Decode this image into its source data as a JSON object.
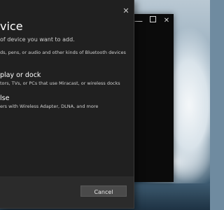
{
  "dialog": {
    "title": "vice",
    "subtitle": "of device you want to add.",
    "close_glyph": "✕",
    "options": [
      {
        "title": "",
        "desc": "ds, pens, or audio and other kinds of Bluetooth devices"
      },
      {
        "title": "play or dock",
        "desc": "tors, TVs, or PCs that use Miracast, or wireless docks"
      },
      {
        "title": "lse",
        "desc": "ers with Wireless Adapter, DLNA, and more"
      }
    ],
    "cancel_label": "Cancel"
  },
  "back_window": {
    "minimize_glyph": "—",
    "close_glyph": "✕"
  },
  "colors": {
    "dialog_bg": "#202020",
    "footer_bg": "#2b2b2b",
    "button_bg": "#4a4a4a"
  }
}
